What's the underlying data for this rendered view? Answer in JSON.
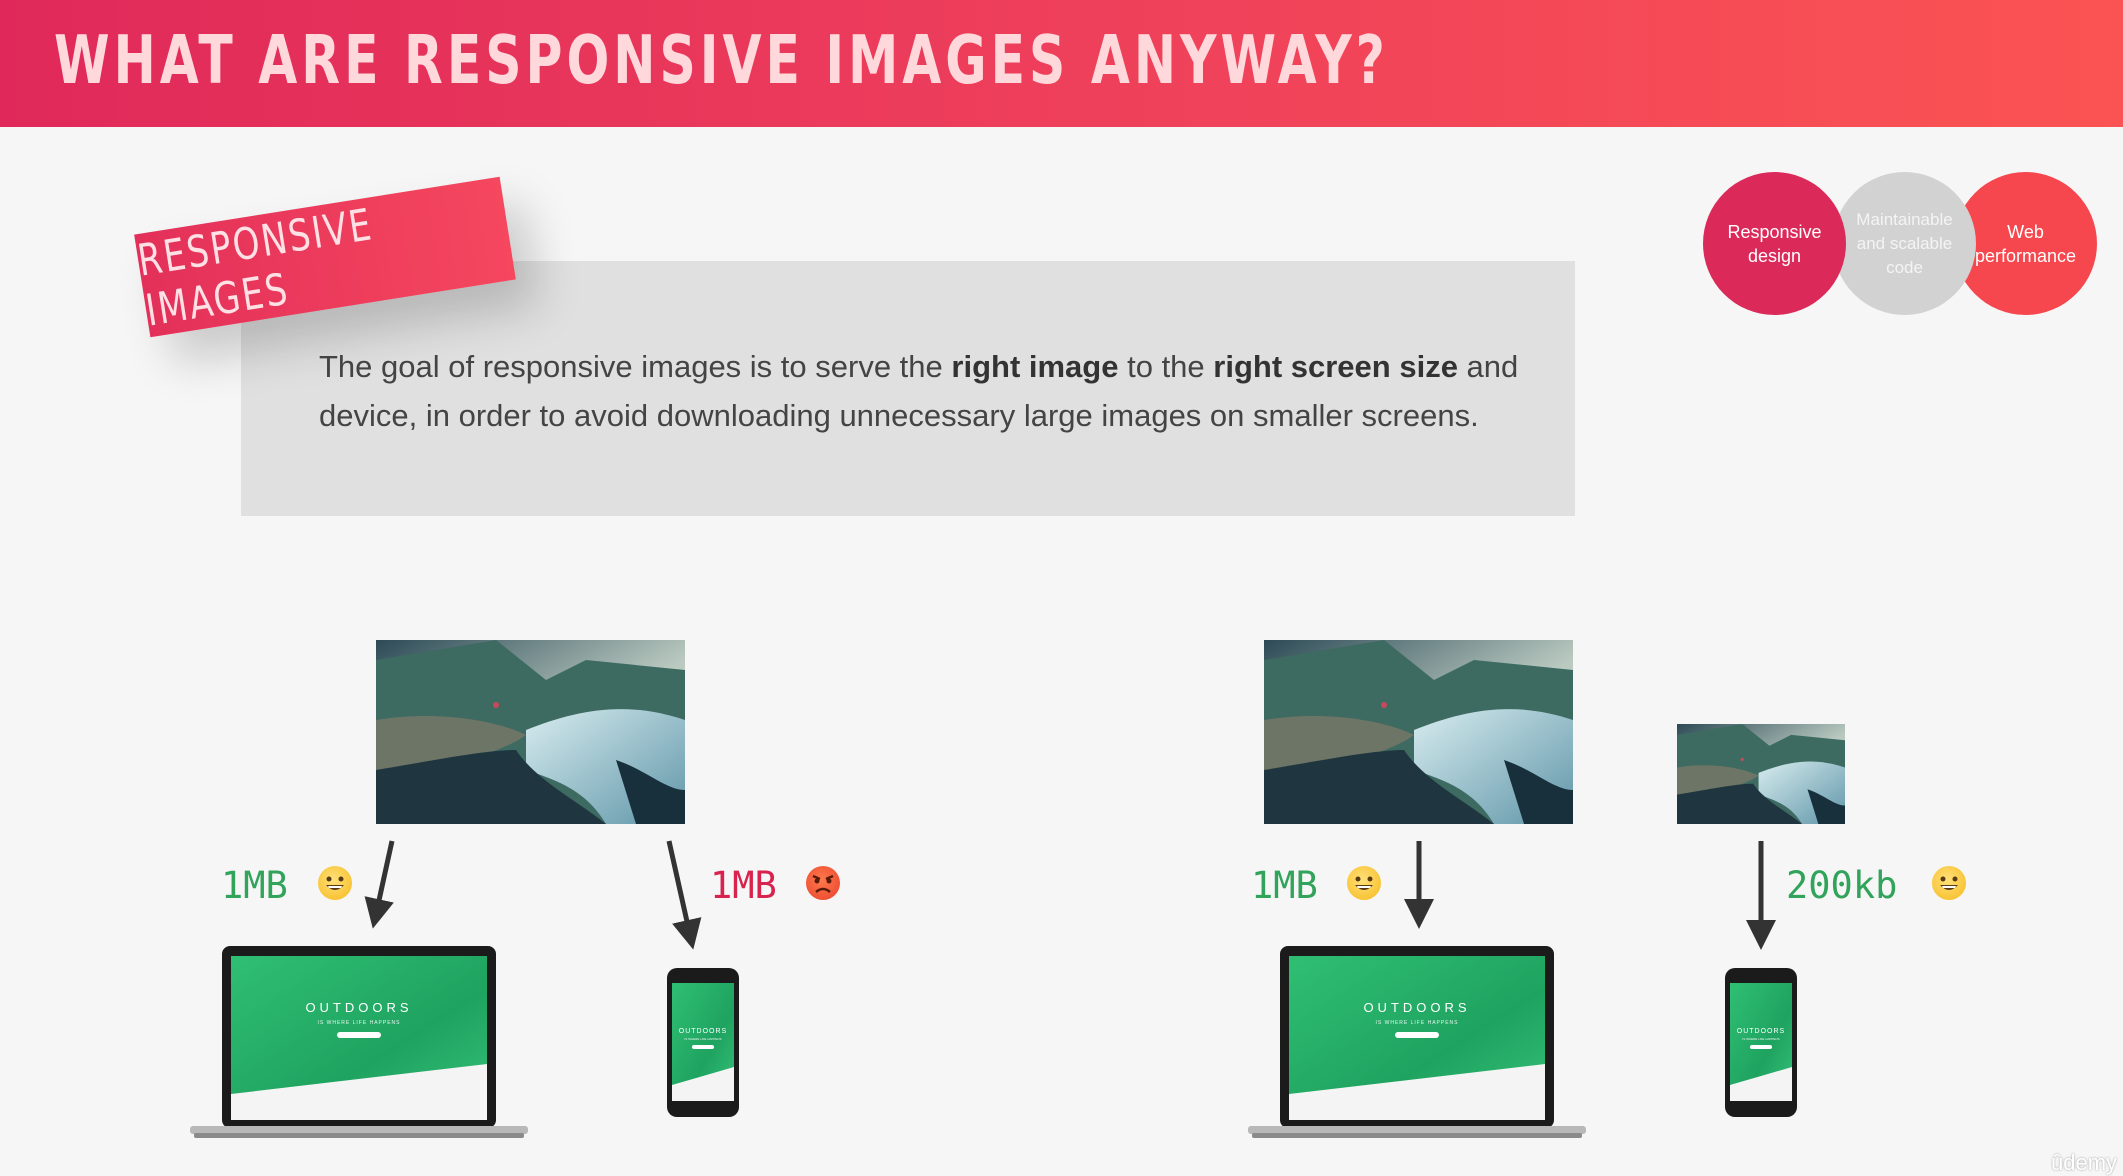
{
  "header": {
    "title": "WHAT ARE RESPONSIVE IMAGES ANYWAY?"
  },
  "tag": {
    "label": "RESPONSIVE IMAGES"
  },
  "venn": {
    "circles": [
      {
        "label": "Responsive design",
        "color": "#db2a5a"
      },
      {
        "label": "Maintainable and scalable code",
        "color": "#d2d2d2"
      },
      {
        "label": "Web performance",
        "color": "#f6474f"
      }
    ]
  },
  "description": {
    "part1": "The goal of responsive images is to serve the ",
    "bold1": "right image",
    "part2": " to the ",
    "bold2": "right screen size",
    "part3": " and device, in order to avoid downloading unnecessary large images on smaller screens."
  },
  "scenario_left": {
    "laptop_size": "1MB",
    "laptop_emoji": "grinning-face",
    "phone_size": "1MB",
    "phone_emoji": "angry-face"
  },
  "scenario_right": {
    "laptop_size": "1MB",
    "laptop_emoji": "grinning-face",
    "phone_size": "200kb",
    "phone_emoji": "grinning-face"
  },
  "device_screen": {
    "heading": "OUTDOORS",
    "subheading": "IS WHERE LIFE HAPPENS"
  },
  "colors": {
    "green": "#32a35a",
    "red": "#d9234f",
    "header_start": "#e0295a",
    "header_end": "#fb5353"
  },
  "watermark": "ûdemy"
}
